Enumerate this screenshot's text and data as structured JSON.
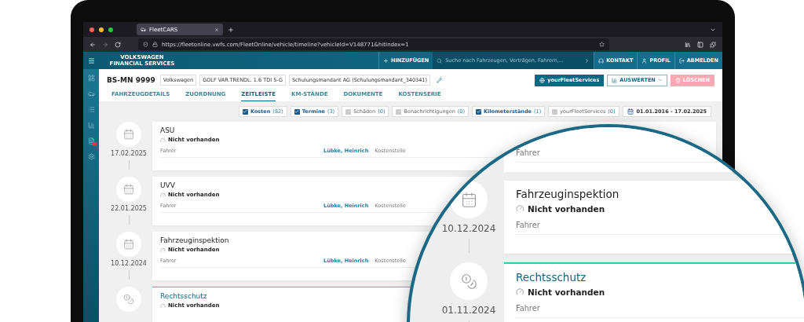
{
  "browser": {
    "tab_title": "FleetCARS",
    "url": "https://fleetonline.vwfs.com/FleetOnline/vehicle/timeline?vehicleId=V148771&hitIndex=1"
  },
  "header": {
    "brand_lines": [
      "VOLKSWAGEN",
      "FINANCIAL SERVICES"
    ],
    "add_label": "HINZUFÜGEN",
    "search_placeholder": "Suche nach Fahrzeugen, Verträgen, Fahrern,...",
    "links": [
      {
        "kind": "contact",
        "label": "KONTAKT"
      },
      {
        "kind": "profile",
        "label": "PROFIL"
      },
      {
        "kind": "logout",
        "label": "ABMELDEN"
      }
    ]
  },
  "sidebar": {
    "items": [
      {
        "kind": "dashboard",
        "badge": false
      },
      {
        "kind": "car",
        "badge": false
      },
      {
        "kind": "list",
        "badge": false
      },
      {
        "kind": "chart",
        "badge": false
      },
      {
        "kind": "document",
        "badge": true
      },
      {
        "kind": "settings",
        "badge": false
      }
    ]
  },
  "vehicle": {
    "plate": "BS-MN 9999",
    "tags": [
      "Volkswagen",
      "GOLF VAR.TRENDL. 1.6 TDI 5-G",
      "Schulungsmandant AG (Schulungsmandant_340341)"
    ]
  },
  "actions": [
    {
      "kind": "primary",
      "label": "yourFleetServices"
    },
    {
      "kind": "outline",
      "label": "AUSWERTEN"
    },
    {
      "kind": "disabled",
      "label": "LÖSCHEN"
    }
  ],
  "tabs": [
    {
      "label": "FAHRZEUGDETAILS",
      "selected": false
    },
    {
      "label": "ZUORDNUNG",
      "selected": false
    },
    {
      "label": "ZEITLEISTE",
      "selected": true
    },
    {
      "label": "KM-STÄNDE",
      "selected": false
    },
    {
      "label": "DOKUMENTE",
      "selected": false
    },
    {
      "label": "KOSTENSERIE",
      "selected": false
    }
  ],
  "filters": [
    {
      "label": "Kosten",
      "count": "(82)",
      "checked": true
    },
    {
      "label": "Termine",
      "count": "(3)",
      "checked": true
    },
    {
      "label": "Schäden",
      "count": "(0)",
      "checked": false
    },
    {
      "label": "Benachrichtigungen",
      "count": "(0)",
      "checked": false
    },
    {
      "label": "Kilometerstände",
      "count": "(1)",
      "checked": true
    },
    {
      "label": "yourFleetServices",
      "count": "(0)",
      "checked": false
    }
  ],
  "date_range": "01.01.2016 - 17.02.2025",
  "timeline": [
    {
      "kind": "appointment",
      "date": "17.02.2025",
      "title": "ASU",
      "status": "Nicht vorhanden",
      "driver_label": "Fahrer",
      "driver": "Lübke, Heinrich",
      "cost_center_label": "Kostenstelle",
      "highlighted": false
    },
    {
      "kind": "appointment",
      "date": "22.01.2025",
      "title": "UVV",
      "status": "Nicht vorhanden",
      "driver_label": "Fahrer",
      "driver": "Lübke, Heinrich",
      "cost_center_label": "Kostenstelle",
      "highlighted": false
    },
    {
      "kind": "appointment",
      "date": "10.12.2024",
      "title": "Fahrzeuginspektion",
      "status": "Nicht vorhanden",
      "driver_label": "Fahrer",
      "driver": "Lübke, Heinrich",
      "cost_center_label": "Kostenstelle",
      "highlighted": false
    },
    {
      "kind": "cost",
      "title": "Rechtsschutz",
      "status": "Nicht vorhanden",
      "highlighted": true
    }
  ],
  "magnifier": {
    "partial_driver_label": "Fahrer",
    "items": [
      {
        "kind": "appointment",
        "date": "10.12.2024",
        "title": "Fahrzeuginspektion",
        "status": "Nicht vorhanden",
        "driver_label": "Fahrer",
        "highlighted": false
      },
      {
        "kind": "cost",
        "date": "01.11.2024",
        "title": "Rechtsschutz",
        "status": "Nicht vorhanden",
        "driver_label": "Fahrer",
        "highlighted": true
      }
    ]
  }
}
